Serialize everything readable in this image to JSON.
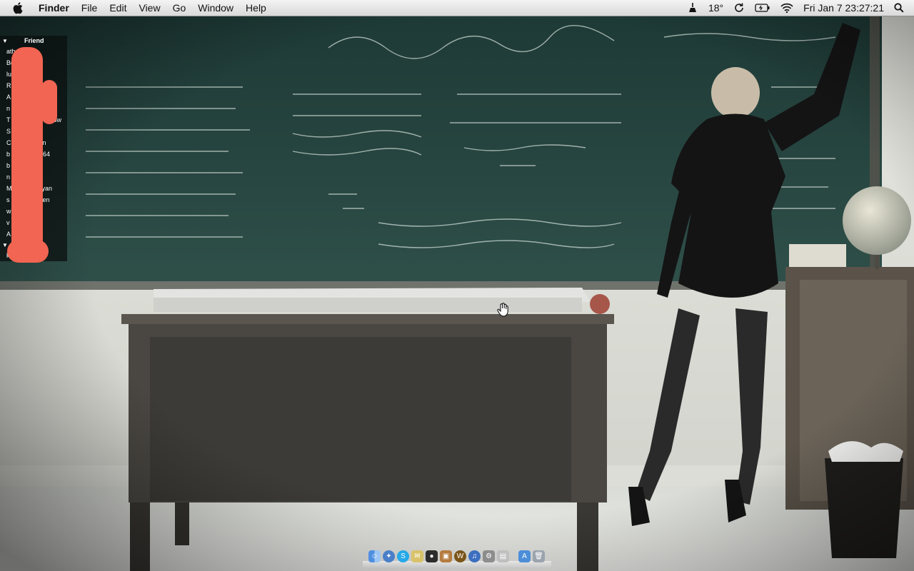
{
  "menubar": {
    "app_name": "Finder",
    "menus": [
      "File",
      "Edit",
      "View",
      "Go",
      "Window",
      "Help"
    ],
    "status": {
      "weather": "18°",
      "datetime": "Fri Jan 7  23:27:21"
    },
    "icons": [
      "apple-icon",
      "broom-icon",
      "sync-icon",
      "battery-icon",
      "wifi-icon",
      "spotlight-icon"
    ]
  },
  "widget": {
    "section1_title": "Friend",
    "rows": [
      "ath",
      "Be",
      "lu",
      "R",
      "A",
      "n",
      "T",
      "S",
      "C",
      "b",
      "b",
      "n",
      "M",
      "s",
      "w",
      "v",
      "A"
    ],
    "row_suffixes": [
      "",
      "",
      "",
      "00",
      "o",
      "",
      "ow",
      "",
      "n",
      "64",
      "",
      "",
      "yan",
      "en",
      "",
      "",
      ""
    ],
    "section2_title": "te",
    "section2_rows": [
      "k"
    ]
  },
  "dock": {
    "icons": [
      "finder-icon",
      "safari-icon",
      "skype-icon",
      "mail-icon",
      "adium-icon",
      "preview-icon",
      "wow-icon",
      "itunes-icon",
      "system-prefs-icon",
      "photo-icon",
      "app-store-icon",
      "trash-icon"
    ]
  }
}
